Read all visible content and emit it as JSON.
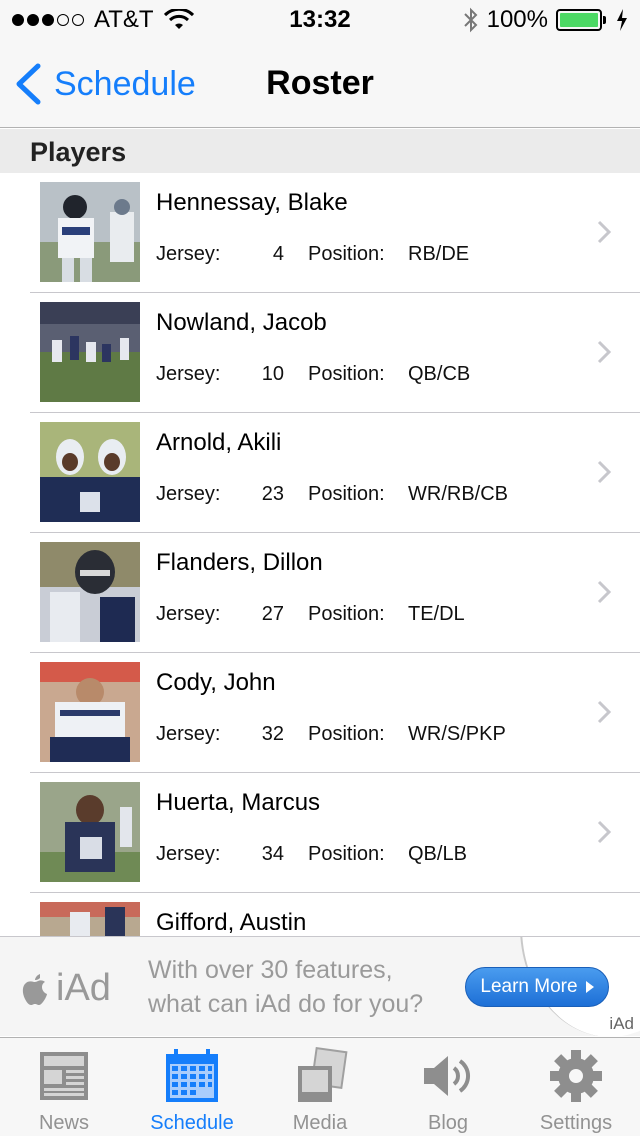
{
  "status_bar": {
    "carrier": "AT&T",
    "time": "13:32",
    "battery": "100%",
    "signal_dots_filled": 3,
    "signal_dots_total": 5
  },
  "nav": {
    "back_label": "Schedule",
    "title": "Roster"
  },
  "section": {
    "title": "Players"
  },
  "labels": {
    "jersey": "Jersey:",
    "position": "Position:"
  },
  "players": [
    {
      "name": "Hennessay, Blake",
      "jersey": "4",
      "position": "RB/DE"
    },
    {
      "name": "Nowland, Jacob",
      "jersey": "10",
      "position": "QB/CB"
    },
    {
      "name": "Arnold, Akili",
      "jersey": "23",
      "position": "WR/RB/CB"
    },
    {
      "name": "Flanders, Dillon",
      "jersey": "27",
      "position": "TE/DL"
    },
    {
      "name": "Cody, John",
      "jersey": "32",
      "position": "WR/S/PKP"
    },
    {
      "name": "Huerta, Marcus",
      "jersey": "34",
      "position": "QB/LB"
    },
    {
      "name": "Gifford, Austin"
    }
  ],
  "ad": {
    "brand": "iAd",
    "text_line1": "With over 30 features,",
    "text_line2": "what can iAd do for you?",
    "button_label": "Learn More",
    "corner_label": "iAd"
  },
  "tabs": [
    {
      "label": "News",
      "icon": "newspaper-icon",
      "active": false
    },
    {
      "label": "Schedule",
      "icon": "calendar-icon",
      "active": true
    },
    {
      "label": "Media",
      "icon": "media-icon",
      "active": false
    },
    {
      "label": "Blog",
      "icon": "speaker-icon",
      "active": false
    },
    {
      "label": "Settings",
      "icon": "gear-icon",
      "active": false
    }
  ],
  "colors": {
    "accent": "#157efb",
    "battery": "#4cd964",
    "inactive_tab": "#929292"
  }
}
